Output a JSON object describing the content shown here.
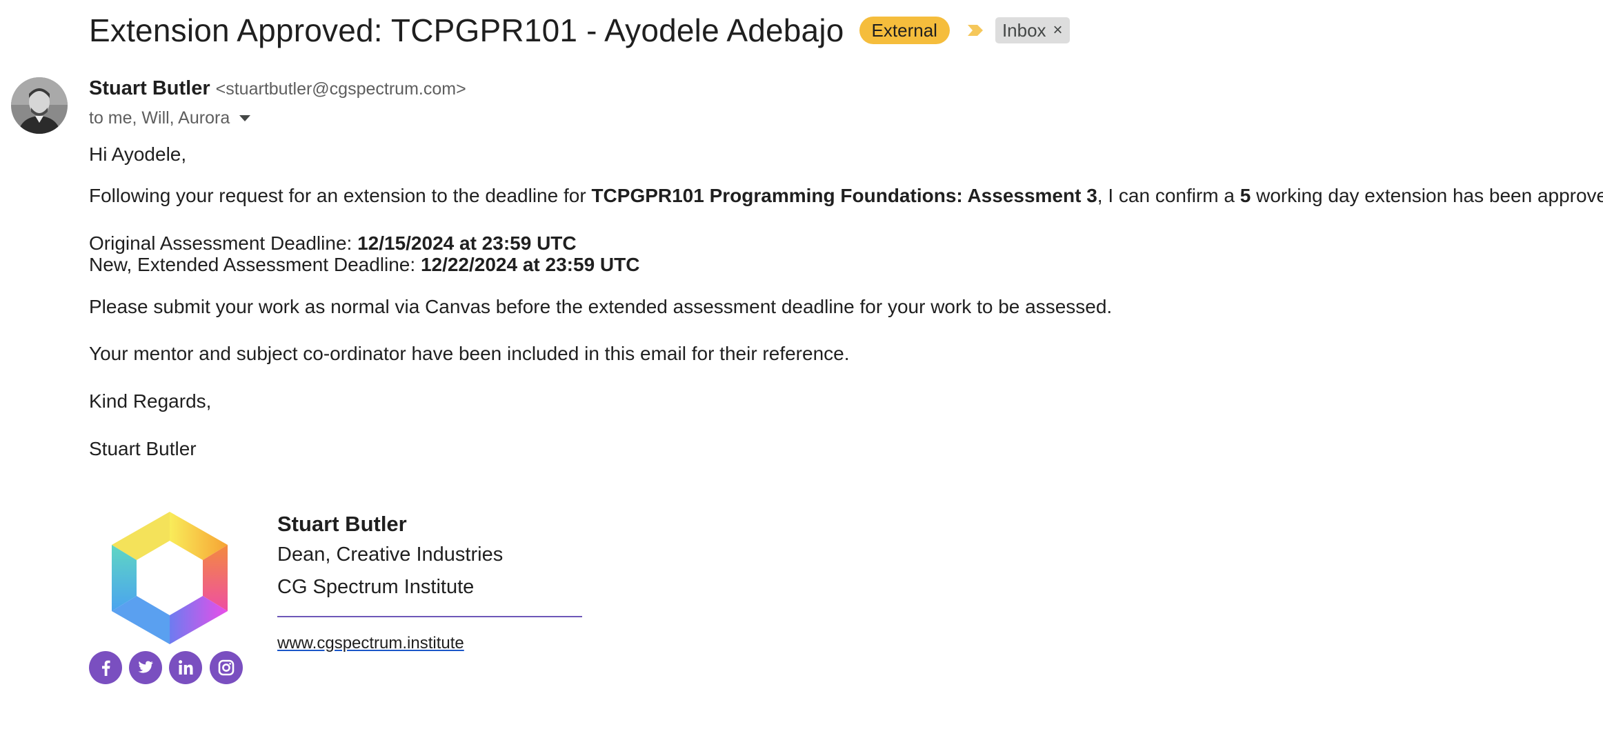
{
  "email": {
    "subject": "Extension Approved: TCPGPR101 - Ayodele Adebajo",
    "labels": {
      "external": "External",
      "inbox": "Inbox",
      "inbox_remove": "×"
    },
    "sender": {
      "name": "Stuart Butler",
      "email": "<stuartbutler@cgspectrum.com>"
    },
    "recipients": "to me, Will, Aurora",
    "body": {
      "greeting": "Hi Ayodele,",
      "p1_pre": "Following your request for an extension to the deadline for ",
      "p1_course": "TCPGPR101 Programming Foundations: Assessment 3",
      "p1_mid": ", I can confirm a ",
      "p1_days": "5",
      "p1_post": " working day extension has been approved.",
      "orig_label": "Original Assessment Deadline: ",
      "orig_value": "12/15/2024 at 23:59 UTC",
      "new_label": "New, Extended Assessment Deadline: ",
      "new_value": "12/22/2024 at 23:59 UTC",
      "p_submit": "Please submit your work as normal via Canvas before the extended assessment deadline for your work to be assessed.",
      "p_mentor": "Your mentor and subject co-ordinator have been included in this email for their reference.",
      "closing": "Kind Regards,",
      "sign_name": "Stuart Butler"
    },
    "signature": {
      "name": "Stuart Butler",
      "title": "Dean, Creative Industries",
      "organization": "CG Spectrum Institute",
      "website": "www.cgspectrum.institute",
      "social": [
        "facebook-icon",
        "twitter-icon",
        "linkedin-icon",
        "instagram-icon"
      ]
    },
    "colors": {
      "external_badge": "#f5bd3c",
      "inbox_badge": "#dddddd",
      "social_icon_bg": "#7a4fc0",
      "divider": "#6d57b8"
    }
  }
}
